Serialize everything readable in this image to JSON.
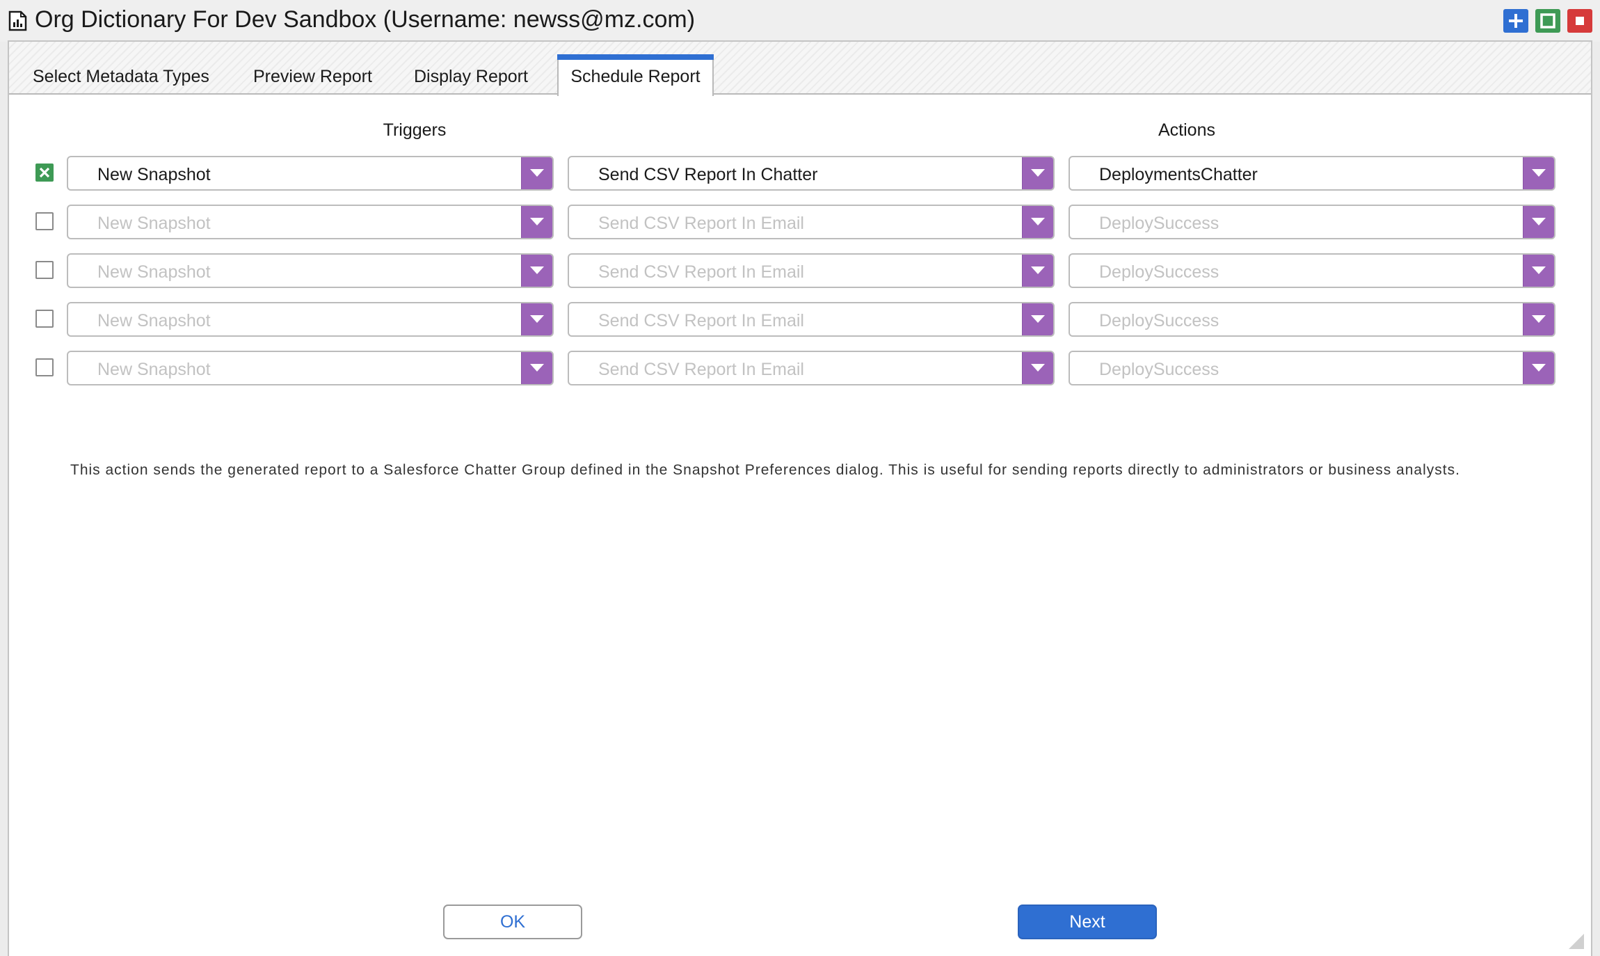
{
  "window": {
    "title": "Org Dictionary For Dev Sandbox (Username: newss@mz.com)",
    "icon": "document-chart-icon",
    "controls": [
      {
        "name": "add-window-button",
        "icon": "plus-icon",
        "color": "#2f6fd2"
      },
      {
        "name": "maximize-button",
        "icon": "square-icon",
        "color": "#3e9a55"
      },
      {
        "name": "close-button",
        "icon": "stop-icon",
        "color": "#d63a3a"
      }
    ]
  },
  "tabs": [
    {
      "label": "Select Metadata Types",
      "active": false
    },
    {
      "label": "Preview Report",
      "active": false
    },
    {
      "label": "Display Report",
      "active": false
    },
    {
      "label": "Schedule Report",
      "active": true
    }
  ],
  "columns": {
    "triggers": "Triggers",
    "actions": "Actions"
  },
  "rows": [
    {
      "checked": true,
      "trigger": "New Snapshot",
      "action": "Send CSV Report In Chatter",
      "target": "DeploymentsChatter"
    },
    {
      "checked": false,
      "trigger": "New Snapshot",
      "action": "Send CSV Report In Email",
      "target": "DeploySuccess"
    },
    {
      "checked": false,
      "trigger": "New Snapshot",
      "action": "Send CSV Report In Email",
      "target": "DeploySuccess"
    },
    {
      "checked": false,
      "trigger": "New Snapshot",
      "action": "Send CSV Report In Email",
      "target": "DeploySuccess"
    },
    {
      "checked": false,
      "trigger": "New Snapshot",
      "action": "Send CSV Report In Email",
      "target": "DeploySuccess"
    }
  ],
  "description": "This action sends the generated report to a Salesforce Chatter Group defined in the Snapshot Preferences dialog. This is useful for sending reports directly to administrators or business analysts.",
  "buttons": {
    "ok": "OK",
    "next": "Next"
  },
  "colors": {
    "accent": "#2f6fd2",
    "dropdown_arrow": "#9b63b8",
    "checkbox_checked": "#3e9a55"
  }
}
